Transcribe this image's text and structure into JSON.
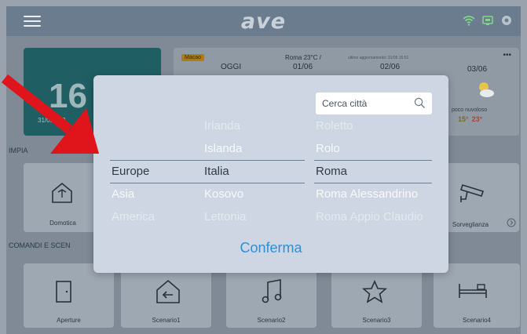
{
  "topbar": {
    "logo": "ave"
  },
  "clock": {
    "time": "16",
    "date": "31/05/202"
  },
  "weather": {
    "badge": "Macao",
    "today": "OGGI",
    "city_temp": "Roma 23°C /",
    "update": "ultimo aggiornamento: 31/05 16:51",
    "day1": "01/06",
    "day2": "02/06",
    "day3": "03/06",
    "menu": "•••",
    "condition": "poco nuvoloso",
    "tmin": "15°",
    "tmax": "23°"
  },
  "sections": {
    "impianti": "IMPIA",
    "comandi": "COMANDI E SCEN"
  },
  "tiles": {
    "domotica": "Domotica",
    "sorveglianza": "Sorveglianza"
  },
  "scenari": [
    "Aperture",
    "Scenario1",
    "Scenario2",
    "Scenario3",
    "Scenario4"
  ],
  "picker": {
    "search_placeholder": "Cerca città",
    "regions": [
      "Europe",
      "Asia",
      "America"
    ],
    "countries": [
      "Irlanda",
      "Islanda",
      "Italia",
      "Kosovo",
      "Lettonia"
    ],
    "cities": [
      "Roletto",
      "Rolo",
      "Roma",
      "Roma Alessandrino",
      "Roma Appio Claudio"
    ],
    "confirm_label": "Conferma"
  },
  "colors": {
    "accent": "#2f8fd3",
    "arrow": "#e0141b",
    "modal_bg": "#cdd6e2"
  }
}
